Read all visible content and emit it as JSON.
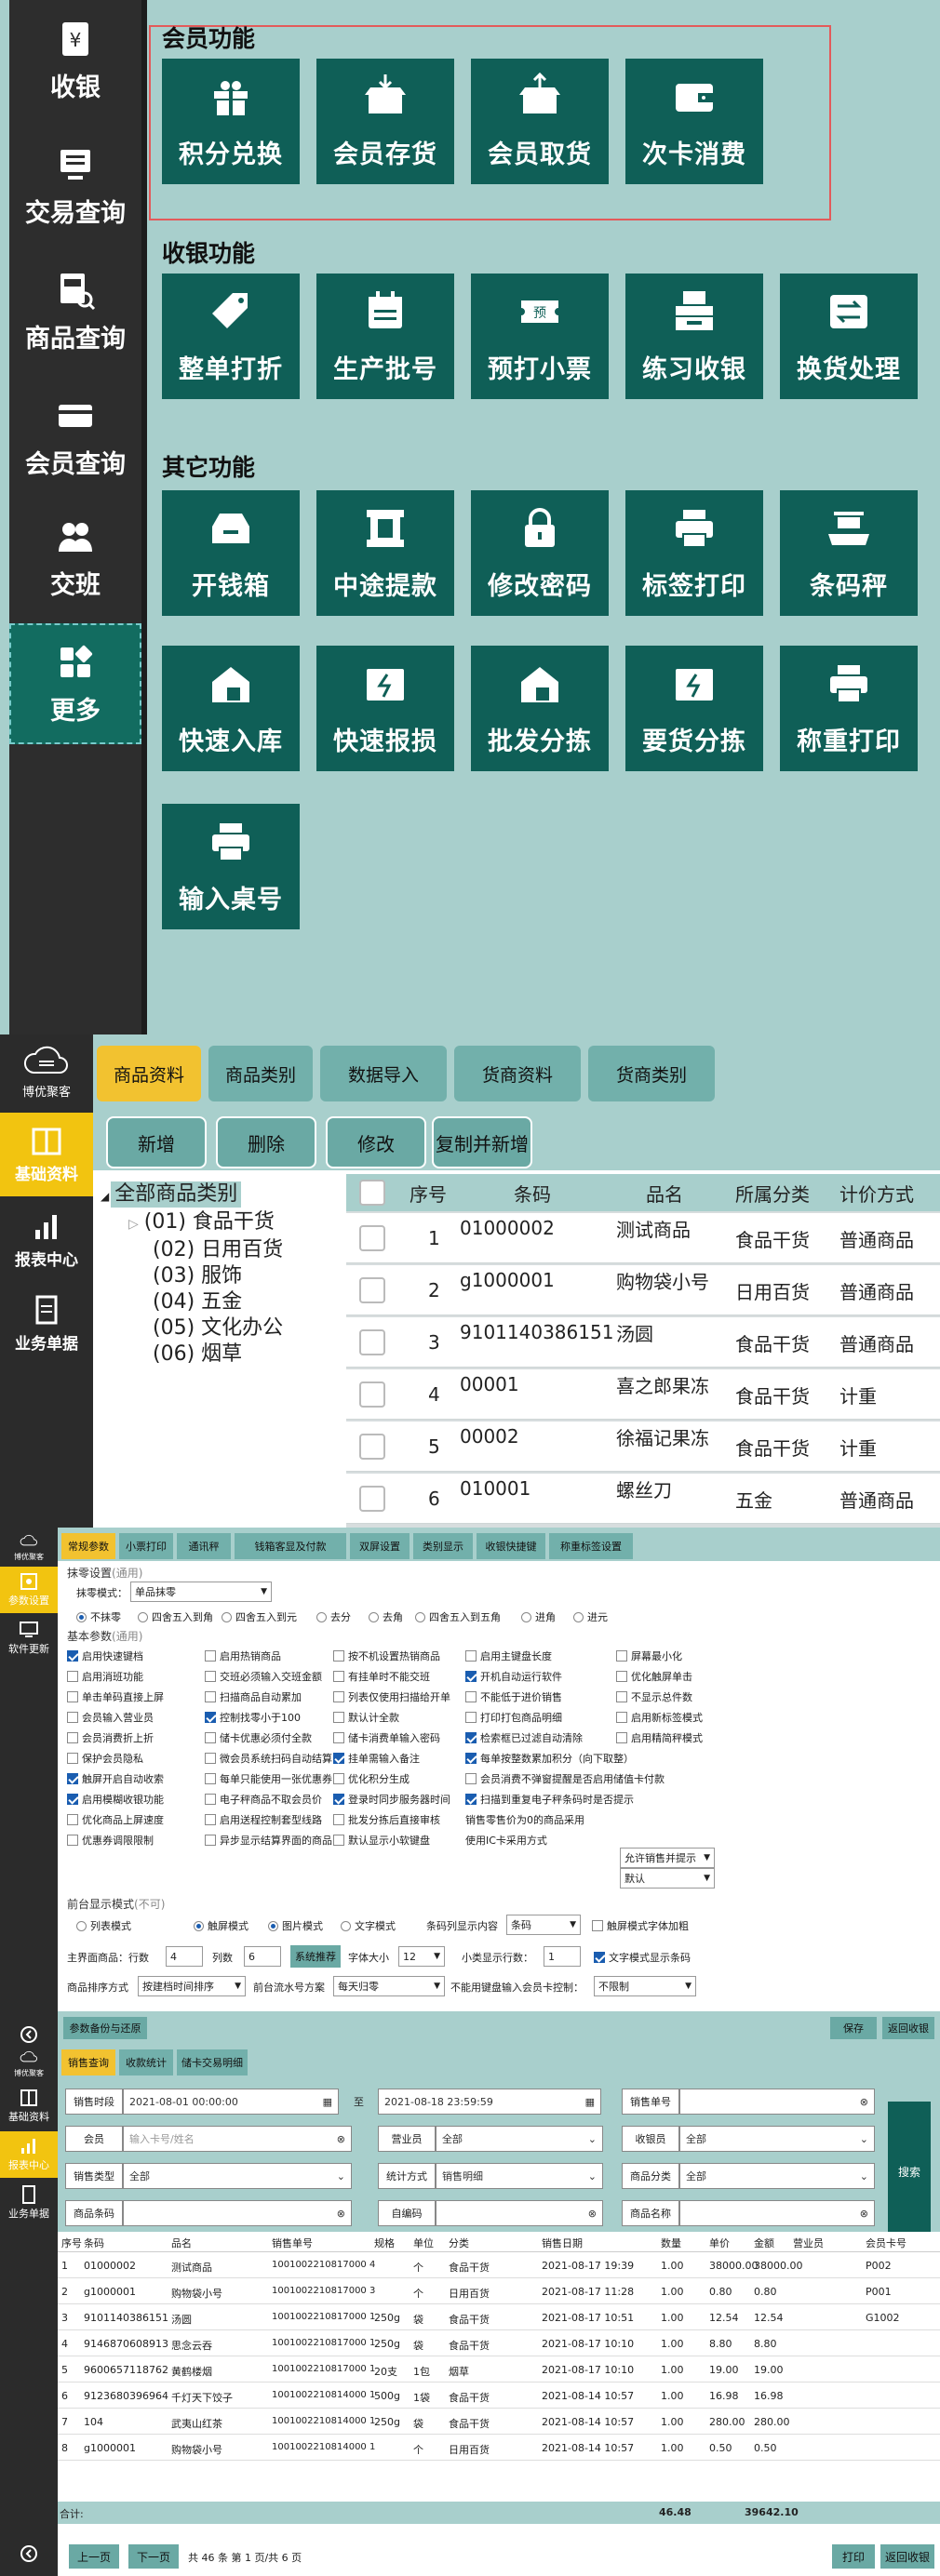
{
  "panel1": {
    "sidebar": [
      {
        "label": "收银",
        "icon": "cash-register-icon"
      },
      {
        "label": "交易查询",
        "icon": "monitor-icon"
      },
      {
        "label": "商品查询",
        "icon": "product-search-icon"
      },
      {
        "label": "会员查询",
        "icon": "card-icon"
      },
      {
        "label": "交班",
        "icon": "handover-icon"
      },
      {
        "label": "更多",
        "icon": "grid-icon"
      }
    ],
    "groups": {
      "member": {
        "title": "会员功能",
        "tiles": [
          "积分兑换",
          "会员存货",
          "会员取货",
          "次卡消费"
        ]
      },
      "cashier": {
        "title": "收银功能",
        "tiles": [
          "整单打折",
          "生产批号",
          "预打小票",
          "练习收银",
          "换货处理"
        ]
      },
      "other": {
        "title": "其它功能",
        "tiles": [
          "开钱箱",
          "中途提款",
          "修改密码",
          "标签打印",
          "条码秤",
          "快速入库",
          "快速报损",
          "批发分拣",
          "要货分拣",
          "称重打印",
          "输入桌号"
        ]
      }
    }
  },
  "panel2": {
    "logo_text": "博优聚客",
    "sidebar": [
      "基础资料",
      "报表中心",
      "业务单据"
    ],
    "tabs": [
      "商品资料",
      "商品类别",
      "数据导入",
      "货商资料",
      "货商类别"
    ],
    "toolbar": [
      "新增",
      "删除",
      "修改",
      "复制并新增"
    ],
    "tree": {
      "root": "全部商品类别",
      "children": [
        "(01) 食品干货",
        "(02) 日用百货",
        "(03) 服饰",
        "(04) 五金",
        "(05) 文化办公",
        "(06) 烟草"
      ]
    },
    "grid": {
      "headers": [
        "序号",
        "条码",
        "品名",
        "所属分类",
        "计价方式"
      ],
      "rows": [
        [
          "1",
          "01000002",
          "测试商品",
          "食品干货",
          "普通商品"
        ],
        [
          "2",
          "g1000001",
          "购物袋小号",
          "日用百货",
          "普通商品"
        ],
        [
          "3",
          "9101140386151",
          "汤圆",
          "食品干货",
          "普通商品"
        ],
        [
          "4",
          "00001",
          "喜之郎果冻",
          "食品干货",
          "计重"
        ],
        [
          "5",
          "00002",
          "徐福记果冻",
          "食品干货",
          "计重"
        ],
        [
          "6",
          "010001",
          "螺丝刀",
          "五金",
          "普通商品"
        ]
      ]
    }
  },
  "panel3": {
    "logo_text": "博优聚客",
    "sidebar": [
      "参数设置",
      "软件更新"
    ],
    "tabs": [
      "常规参数",
      "小票打印",
      "通讯秤",
      "钱箱客显及付款",
      "双屏设置",
      "类别显示",
      "收银快捷键",
      "称重标签设置"
    ],
    "section1": {
      "title": "抹零设置",
      "hint": "(通用)",
      "mode_label": "抹零模式：",
      "mode_value": "单品抹零",
      "radios": [
        "不抹零",
        "四舍五入到角",
        "四舍五入到元",
        "去分",
        "去角",
        "四舍五入到五角",
        "进角",
        "进元"
      ]
    },
    "section2": {
      "title": "基本参数",
      "hint": "(通用)",
      "options": [
        [
          "启用快速键档",
          "启用热销商品",
          "按不机设置热销商品",
          "启用主键盘长度",
          "屏幕最小化"
        ],
        [
          "启用消班功能",
          "交班必须输入交班金额",
          "有挂单时不能交班",
          "开机自动运行软件",
          "优化触屏单击"
        ],
        [
          "单击单码直接上屏",
          "扫描商品自动累加",
          "列表仅使用扫描给开单",
          "不能低于进价销售",
          "不显示总件数"
        ],
        [
          "会员输入营业员",
          "控制找零小于100",
          "默认计全款",
          "打印打包商品明细",
          "启用新标签模式"
        ],
        [
          "会员消费折上折",
          "储卡优惠必须付全款",
          "储卡消费单输入密码",
          "检索框已过滤自动清除",
          "启用精简秤模式"
        ],
        [
          "保护会员隐私",
          "微会员系统扫码自动结算",
          "挂单需输入备注",
          "每单按整数累加积分（向下取整）",
          ""
        ],
        [
          "触屏开启自动收索",
          "每单只能使用一张优惠券",
          "优化积分生成",
          "会员消费不弹窗提醒是否启用储值卡付款",
          ""
        ],
        [
          "启用模糊收银功能",
          "电子秤商品不取会员价",
          "登录时同步服务器时间",
          "扫描到重复电子秤条码时是否提示",
          ""
        ],
        [
          "优化商品上屏速度",
          "启用送程控制套型线路",
          "批发分拣后直接审核",
          "销售零售价为0的商品采用",
          ""
        ],
        [
          "优惠券调限限制",
          "异步显示结算界面的商品",
          "默认显示小软键盘",
          "使用IC卡采用方式",
          ""
        ]
      ],
      "zero_price_value": "允许销售并提示",
      "ic_card_value": "默认"
    },
    "section3": {
      "title": "前台显示模式",
      "hint": "(不可)",
      "list_mode": "列表模式",
      "touch_mode": "触屏模式",
      "pic_mode": "图片模式",
      "text_mode": "文字模式",
      "barcode_label": "条码列显示内容",
      "barcode_value": "条码",
      "bold_label": "触屏模式字体加粗",
      "rows_label": "主界面商品：行数",
      "rows_value": "4",
      "cols_label": "列数",
      "cols_value": "6",
      "sys_recommend": "系统推荐",
      "font_label": "字体大小",
      "font_value": "12",
      "sub_rows_label": "小类显示行数：",
      "sub_rows_value": "1",
      "text_bar_label": "文字模式显示条码",
      "sort_label": "商品排序方式",
      "sort_value": "按建档时间排序",
      "serial_label": "前台流水号方案",
      "serial_value": "每天归零",
      "card_label": "不能用键盘输入会员卡控制：",
      "card_value": "不限制"
    },
    "bottom": {
      "param_backup": "参数备份与还原",
      "save": "保存",
      "back": "返回收银"
    }
  },
  "panel4": {
    "logo_text": "博优聚客",
    "sidebar": [
      "基础资料",
      "报表中心",
      "业务单据"
    ],
    "tabs": [
      "销售查询",
      "收款统计",
      "储卡交易明细"
    ],
    "filters": {
      "time_label": "销售时段",
      "time_from": "2021-08-01 00:00:00",
      "to": "至",
      "time_to": "2021-08-18 23:59:59",
      "order_label": "销售单号",
      "member_label": "会员",
      "member_ph": "输入卡号/姓名",
      "clerk_label": "营业员",
      "clerk_value": "全部",
      "cashier_label": "收银员",
      "cashier_value": "全部",
      "type_label": "销售类型",
      "type_value": "全部",
      "stat_label": "统计方式",
      "stat_value": "销售明细",
      "cat_label": "商品分类",
      "cat_value": "全部",
      "barcode_label": "商品条码",
      "code_label": "自编码",
      "name_label": "商品名称",
      "search": "搜索"
    },
    "table": {
      "headers": [
        "序号",
        "条码",
        "品名",
        "销售单号",
        "规格",
        "单位",
        "分类",
        "销售日期",
        "数量",
        "单价",
        "金额",
        "营业员",
        "会员卡号"
      ],
      "rows": [
        [
          "1",
          "01000002",
          "测试商品",
          "1001002210817000 4",
          "",
          "个",
          "食品干货",
          "2021-08-17 19:39",
          "1.00",
          "38000.00",
          "38000.00",
          "",
          "P002"
        ],
        [
          "2",
          "g1000001",
          "购物袋小号",
          "1001002210817000 3",
          "",
          "个",
          "日用百货",
          "2021-08-17 11:28",
          "1.00",
          "0.80",
          "0.80",
          "",
          "P001"
        ],
        [
          "3",
          "9101140386151",
          "汤圆",
          "1001002210817000 1",
          "250g",
          "袋",
          "食品干货",
          "2021-08-17 10:51",
          "1.00",
          "12.54",
          "12.54",
          "",
          "G1002"
        ],
        [
          "4",
          "9146870608913",
          "思念云吞",
          "1001002210817000 1",
          "250g",
          "袋",
          "食品干货",
          "2021-08-17 10:10",
          "1.00",
          "8.80",
          "8.80",
          "",
          ""
        ],
        [
          "5",
          "9600657118762",
          "黄鹤楼烟",
          "1001002210817000 1",
          "20支",
          "1包",
          "烟草",
          "2021-08-17 10:10",
          "1.00",
          "19.00",
          "19.00",
          "",
          ""
        ],
        [
          "6",
          "9123680396964",
          "千灯天下饺子",
          "1001002210814000 1",
          "500g",
          "1袋",
          "食品干货",
          "2021-08-14 10:57",
          "1.00",
          "16.98",
          "16.98",
          "",
          ""
        ],
        [
          "7",
          "104",
          "武夷山红茶",
          "1001002210814000 1",
          "250g",
          "袋",
          "食品干货",
          "2021-08-14 10:57",
          "1.00",
          "280.00",
          "280.00",
          "",
          ""
        ],
        [
          "8",
          "g1000001",
          "购物袋小号",
          "1001002210814000 1",
          "",
          "个",
          "日用百货",
          "2021-08-14 10:57",
          "1.00",
          "0.50",
          "0.50",
          "",
          ""
        ]
      ],
      "sum_label": "合计:",
      "sum_qty": "46.48",
      "sum_amount": "39642.10"
    },
    "pager": {
      "prev": "上一页",
      "next": "下一页",
      "info": "共 46 条  第 1 页/共 6 页",
      "print": "打印",
      "back": "返回收银"
    }
  }
}
